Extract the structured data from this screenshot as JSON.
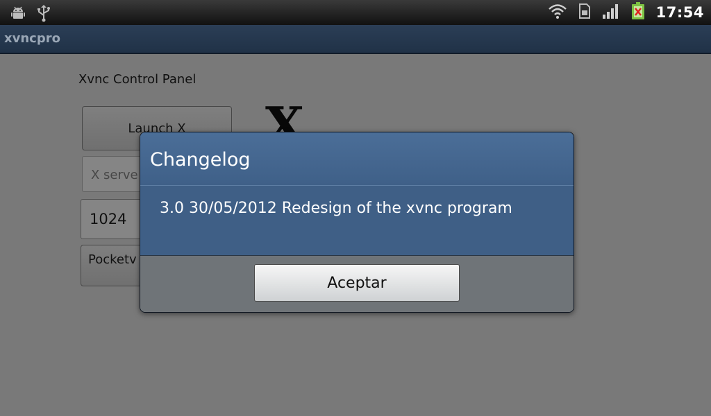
{
  "status_bar": {
    "time": "17:54",
    "left_icons": [
      "android-debug-icon",
      "usb-icon"
    ],
    "right_icons": [
      "wifi-icon",
      "sim-card-icon",
      "signal-icon",
      "battery-icon"
    ]
  },
  "action_bar": {
    "title": "xvncpro"
  },
  "content": {
    "panel_title": "Xvnc Control Panel",
    "launch_button": "Launch X",
    "x_logo": "X",
    "server_field_placeholder": "X serve",
    "width_field_value": "1024",
    "pocket_button": "Pocketv"
  },
  "dialog": {
    "title": "Changelog",
    "message": "3.0 30/05/2012 Redesign of the xvnc program",
    "ok_button": "Aceptar"
  },
  "colors": {
    "dialog_header": "#44668f",
    "dialog_footer": "#6f7478",
    "battery_green": "#7dc242",
    "battery_x": "#e02020"
  }
}
